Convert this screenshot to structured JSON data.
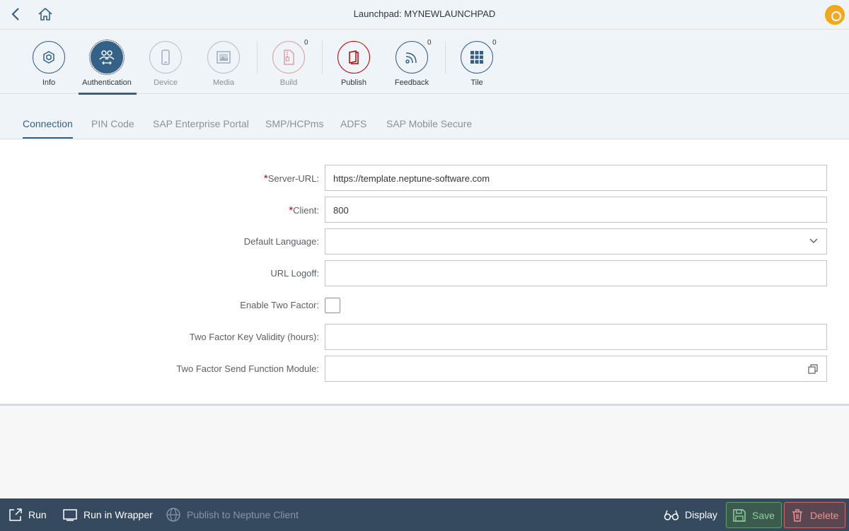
{
  "shell": {
    "title": "Launchpad: MYNEWLAUNCHPAD"
  },
  "icon_tabs": [
    {
      "label": "Info",
      "icon": "cube-icon",
      "count": ""
    },
    {
      "label": "Authentication",
      "icon": "users-icon",
      "count": "",
      "selected": true
    },
    {
      "label": "Device",
      "icon": "phone-icon",
      "count": "",
      "disabled": true
    },
    {
      "label": "Media",
      "icon": "image-icon",
      "count": "",
      "disabled": true
    },
    {
      "label": "Build",
      "icon": "zip-file-icon",
      "count": "0",
      "disabled": true
    },
    {
      "label": "Publish",
      "icon": "book-icon",
      "count": ""
    },
    {
      "label": "Feedback",
      "icon": "feed-icon",
      "count": "0"
    },
    {
      "label": "Tile",
      "icon": "grid-icon",
      "count": "0"
    }
  ],
  "text_tabs": [
    {
      "label": "Connection",
      "active": true
    },
    {
      "label": "PIN Code"
    },
    {
      "label": "SAP Enterprise Portal"
    },
    {
      "label": "SMP/HCPms"
    },
    {
      "label": "ADFS"
    },
    {
      "label": "SAP Mobile Secure"
    }
  ],
  "form": {
    "server_url": {
      "label": "Server-URL:",
      "required": true,
      "value": "https://template.neptune-software.com"
    },
    "client": {
      "label": "Client:",
      "required": true,
      "value": "800"
    },
    "default_language": {
      "label": "Default Language:",
      "value": ""
    },
    "url_logoff": {
      "label": "URL Logoff:",
      "value": ""
    },
    "enable_two_factor": {
      "label": "Enable Two Factor:",
      "checked": false
    },
    "two_factor_validity": {
      "label": "Two Factor Key Validity (hours):",
      "value": ""
    },
    "two_factor_function": {
      "label": "Two Factor Send Function Module:",
      "value": ""
    }
  },
  "footer": {
    "run": "Run",
    "run_wrapper": "Run in Wrapper",
    "publish_client": "Publish to Neptune Client",
    "display": "Display",
    "save": "Save",
    "delete": "Delete"
  },
  "colors": {
    "accent": "#346187",
    "footer_bg": "#354a5f",
    "required": "#bb0000",
    "save": "#8fd19e",
    "delete": "#f09090",
    "avatar": "#f5a623"
  }
}
